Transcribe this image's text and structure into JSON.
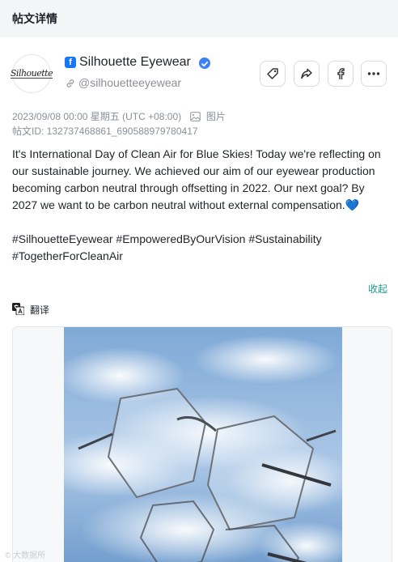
{
  "header": {
    "title": "帖文详情"
  },
  "account": {
    "name": "Silhouette Eyewear",
    "handle": "@silhouetteeyewear",
    "avatar_text": "Silhouette",
    "platform_icon": "facebook-icon",
    "platform_glyph": "f"
  },
  "actions": [
    {
      "name": "tag-button",
      "icon": "tag-icon"
    },
    {
      "name": "share-button",
      "icon": "share-icon"
    },
    {
      "name": "open-facebook-button",
      "icon": "facebook-icon"
    },
    {
      "name": "more-button",
      "icon": "more-icon"
    }
  ],
  "meta": {
    "datetime": "2023/09/08 00:00 星期五 (UTC +08:00)",
    "media_type": "图片",
    "post_id": "帖文ID: 132737468861_690588979780417"
  },
  "post": {
    "text": "It's International Day of Clean Air for Blue Skies! Today we're reflecting on our sustainable journey. We achieved our aim of our eyewear production becoming carbon neutral through offsetting in 2022. Our next goal? By 2027 we want to be carbon neutral without external compensation.💙\n\n#SilhouetteEyewear #EmpoweredByOurVision #Sustainability #TogetherForCleanAir",
    "collapse_label": "收起",
    "translate_label": "翻译"
  },
  "watermark": "© 大数据所",
  "colors": {
    "accent": "#1a9b8c",
    "facebook_blue": "#1877f2",
    "verified_blue": "#3b82f6",
    "header_bg": "#f4f5f7",
    "muted_text": "#8a8f99"
  }
}
